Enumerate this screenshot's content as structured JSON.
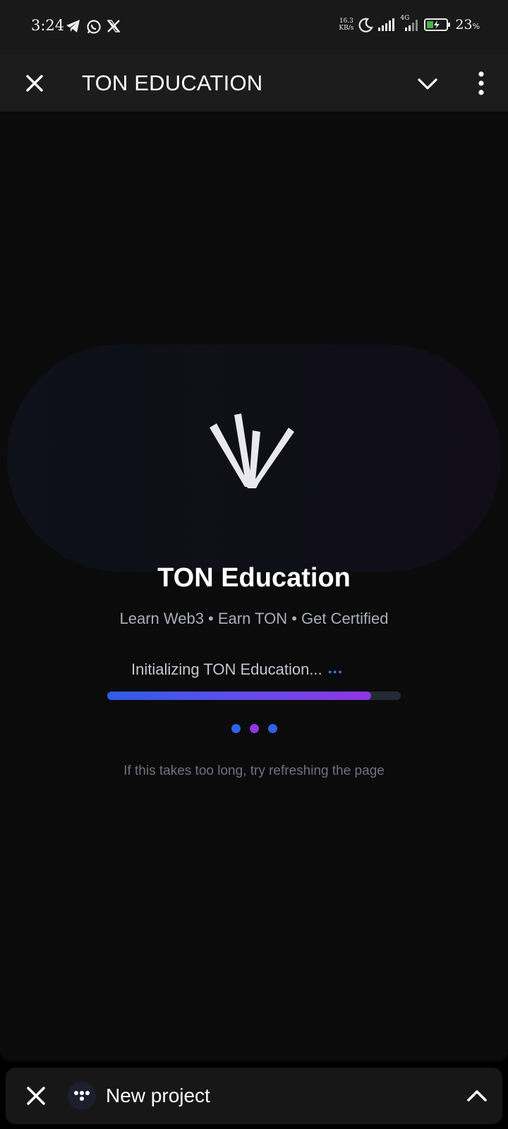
{
  "status_bar": {
    "time": "3:24",
    "left_icons": [
      "telegram-icon",
      "whatsapp-icon",
      "x-icon"
    ],
    "net_speed_value": "16.3",
    "net_speed_unit": "KB/s",
    "network": "4G",
    "battery_percent": "23",
    "battery_unit": "%",
    "battery_color": "#4caf50"
  },
  "header": {
    "title": "TON EDUCATION",
    "icons": [
      "close-icon",
      "chevron-down-icon",
      "more-vertical-icon"
    ]
  },
  "main": {
    "app_name": "TON Education",
    "tagline": "Learn Web3 • Earn TON • Get Certified",
    "loading_text": "Initializing TON Education...",
    "loading_dots": "...",
    "progress": 0.9,
    "hint": "If this takes too long, try refreshing the page",
    "dot_colors": [
      "#2f62e8",
      "#9336e6",
      "#2f62e8"
    ]
  },
  "bottom_bar": {
    "title": "New project",
    "icons": [
      "close-icon",
      "project-avatar-icon",
      "chevron-up-icon"
    ]
  },
  "colors": {
    "accent_blue": "#3b82f6",
    "accent_purple": "#8f35e3",
    "background": "#0b0b0b"
  }
}
